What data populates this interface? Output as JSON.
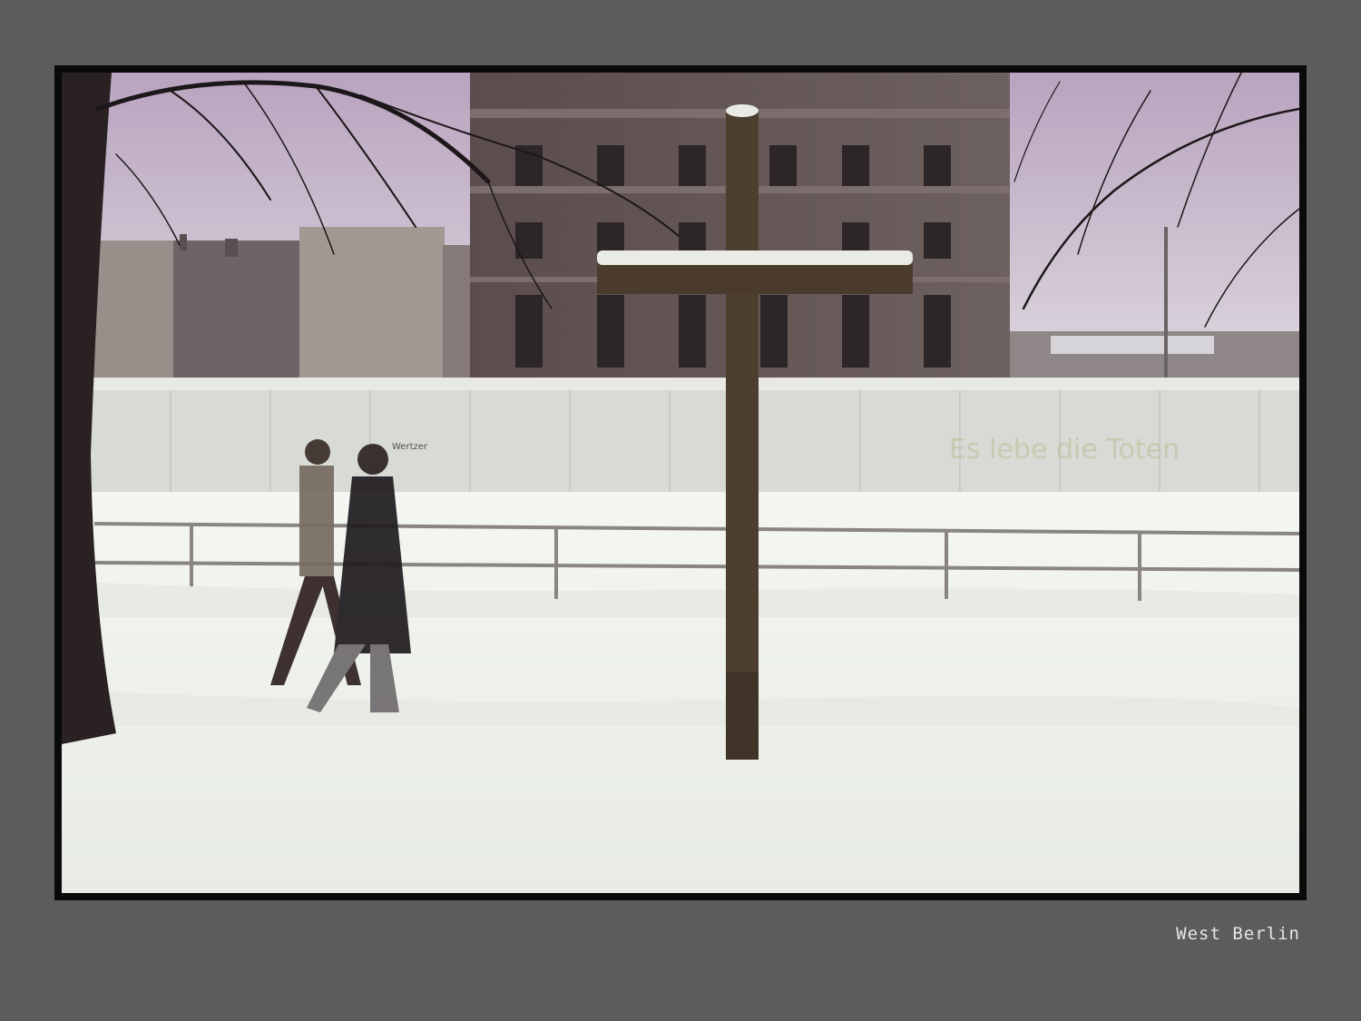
{
  "caption": "West Berlin",
  "photo": {
    "graffiti_left": "Wertzer",
    "graffiti_right": "Es lebe die Toten"
  },
  "colors": {
    "page_background": "#5c5c5c",
    "frame": "#0a0a0a",
    "sky": "#cbbfcf",
    "snow": "#eef1ea",
    "wall": "#d9dbd6",
    "cross": "#4d3f2f"
  }
}
